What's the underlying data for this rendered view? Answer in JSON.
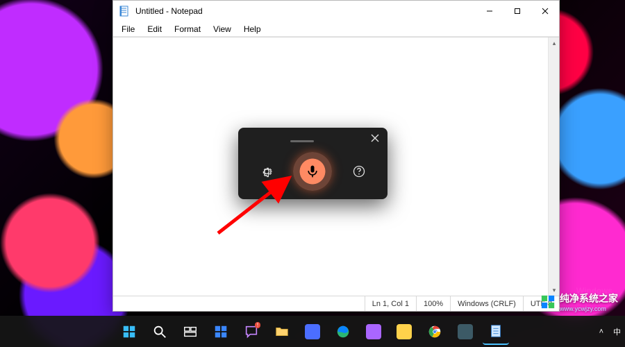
{
  "window": {
    "title": "Untitled - Notepad",
    "menus": [
      "File",
      "Edit",
      "Format",
      "View",
      "Help"
    ],
    "editor_value": "",
    "caret_indicator": "|"
  },
  "statusbar": {
    "position": "Ln 1, Col 1",
    "zoom": "100%",
    "line_ending": "Windows (CRLF)",
    "encoding": "UTF-8"
  },
  "voice_overlay": {
    "settings_icon": "gear-icon",
    "mic_icon": "microphone-icon",
    "help_icon": "help-icon",
    "close_icon": "close-icon",
    "state": "listening"
  },
  "taskbar": {
    "items": [
      {
        "name": "start-button",
        "glyph": "win"
      },
      {
        "name": "search-button",
        "glyph": "search"
      },
      {
        "name": "task-view-button",
        "glyph": "taskview"
      },
      {
        "name": "widgets-button",
        "glyph": "widgets"
      },
      {
        "name": "chat-button",
        "glyph": "chat",
        "badge": "!"
      },
      {
        "name": "file-explorer",
        "glyph": "explorer"
      },
      {
        "name": "app-generic-1",
        "glyph": "square",
        "color": "#4b6eff"
      },
      {
        "name": "edge-browser",
        "glyph": "edge"
      },
      {
        "name": "app-generic-2",
        "glyph": "square",
        "color": "#aa66ff"
      },
      {
        "name": "app-generic-3",
        "glyph": "square",
        "color": "#ffd24b"
      },
      {
        "name": "chrome-browser",
        "glyph": "chrome"
      },
      {
        "name": "app-generic-4",
        "glyph": "square",
        "color": "#3c5a66"
      },
      {
        "name": "notepad-app",
        "glyph": "notepad"
      }
    ]
  },
  "tray": {
    "chevron": "˄",
    "ime": "中",
    "date": ""
  },
  "watermark": {
    "text": "纯净系统之家",
    "url": "www.ycwjzy.com",
    "ghost": "Windows"
  }
}
